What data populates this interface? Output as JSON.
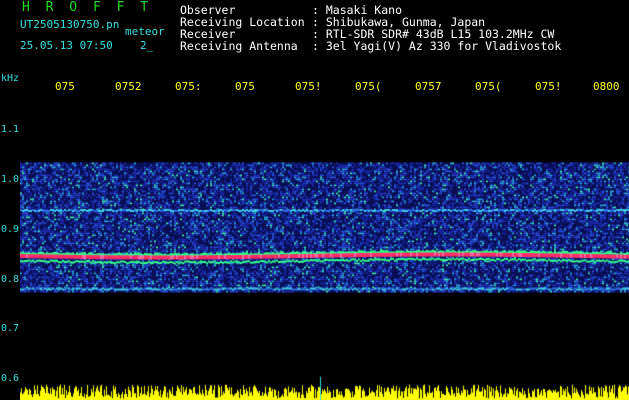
{
  "header": {
    "app_title": "H R O F F T",
    "filename": "UT2505130750.pn",
    "mode": "meteor",
    "datetime": "25.05.13 07:50",
    "count": "2_"
  },
  "info": [
    {
      "label": "Observer",
      "value": ": Masaki Kano"
    },
    {
      "label": "Receiving Location",
      "value": ": Shibukawa, Gunma, Japan"
    },
    {
      "label": "Receiver",
      "value": ": RTL-SDR SDR# 43dB L15 103.2MHz CW"
    },
    {
      "label": "Receiving Antenna",
      "value": ": 3el Yagi(V) Az 330 for Vladivostok"
    }
  ],
  "axis": {
    "y_unit": "kHz",
    "y_ticks": [
      "1.1",
      "1.0",
      "0.9",
      "0.8",
      "0.7",
      "0.6"
    ],
    "x_ticks": [
      "075",
      "0752",
      "075:",
      "075",
      "075!",
      "075(",
      "0757",
      "075(",
      "075!",
      "0800"
    ]
  },
  "chart_data": {
    "type": "heatmap",
    "xlabel": "",
    "ylabel": "kHz",
    "y_range": [
      0.6,
      1.12
    ],
    "noise_band": [
      0.775,
      1.035
    ],
    "traces_khz": [
      0.94,
      0.848,
      0.783
    ],
    "strong_trace_khz": 0.848
  },
  "colors": {
    "background": "#000000",
    "title": "#22dd22",
    "info_text": "#ffffff",
    "axis_text": "#33e0e0",
    "time_labels": "#ffff22",
    "noise_low": "#1a2ab0",
    "trace": "#33ff88",
    "strong_trace": "#ff2a66",
    "level_bars": "#ffff00"
  }
}
